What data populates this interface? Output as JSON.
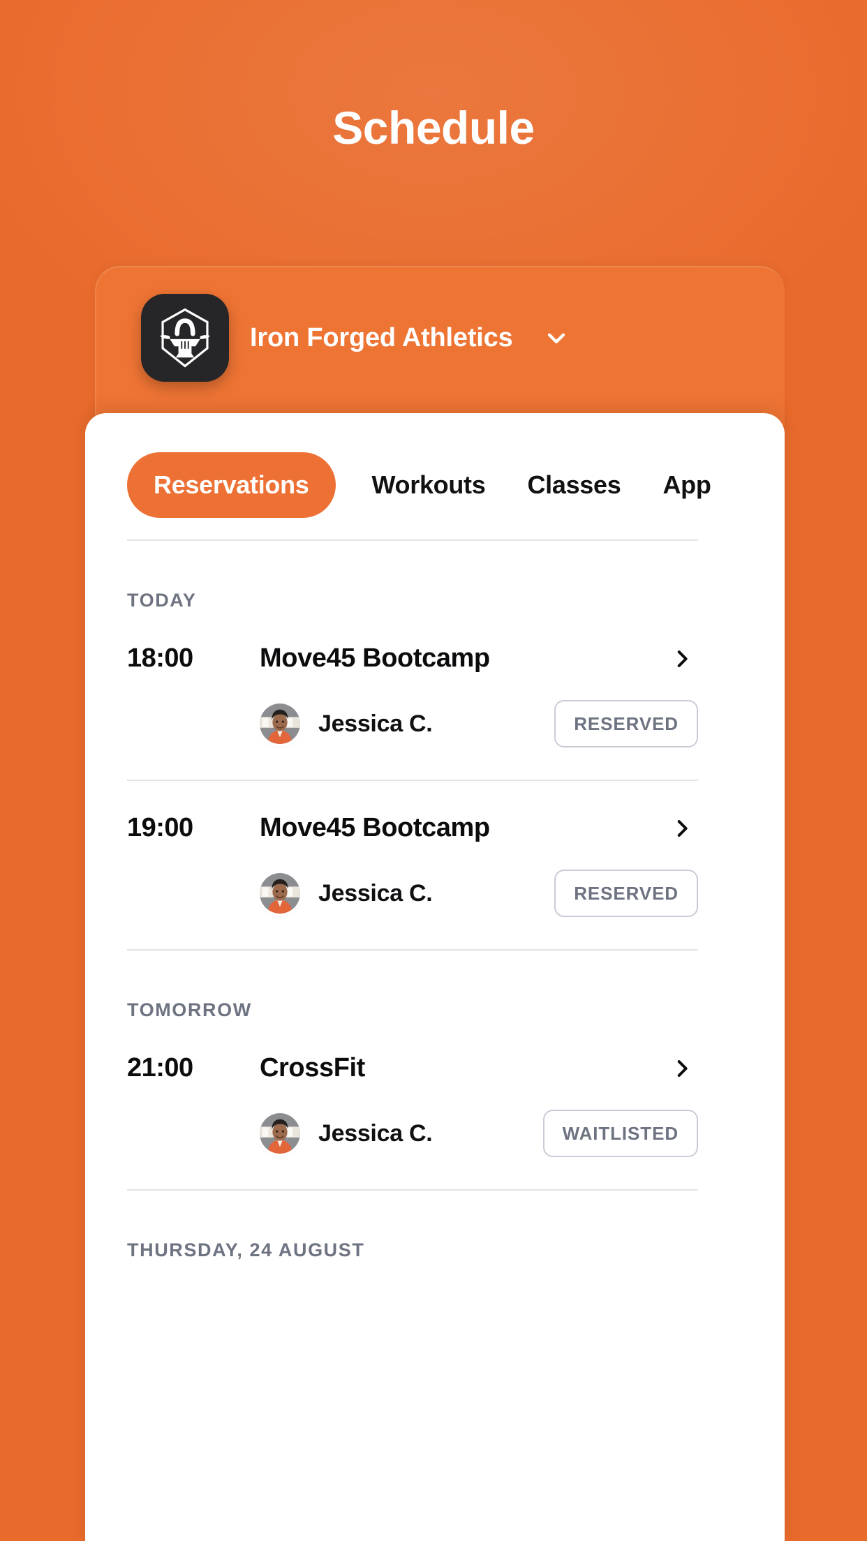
{
  "theme": {
    "brand_orange": "#E96B2C",
    "card_orange": "#EE7434",
    "accent_pill": "#ED7034",
    "text_dark": "#0C0C0E",
    "text_muted": "#6E7382",
    "divider": "#E2E4E8",
    "badge_border": "#C9CCD6",
    "logo_tile": "#262628"
  },
  "header": {
    "title": "Schedule"
  },
  "gym": {
    "name": "Iron Forged Athletics",
    "logo_icon": "anvil-shield-icon",
    "chevron_icon": "chevron-down-icon"
  },
  "tabs": [
    {
      "label": "Reservations",
      "active": true
    },
    {
      "label": "Workouts",
      "active": false
    },
    {
      "label": "Classes",
      "active": false
    },
    {
      "label": "App",
      "active": false
    }
  ],
  "groups": [
    {
      "day_label": "TODAY",
      "sessions": [
        {
          "time": "18:00",
          "name": "Move45 Bootcamp",
          "chevron_icon": "chevron-right-icon",
          "attendees": [
            {
              "name": "Jessica C.",
              "avatar_icon": "avatar-jessica",
              "status": "RESERVED"
            }
          ]
        },
        {
          "time": "19:00",
          "name": "Move45 Bootcamp",
          "chevron_icon": "chevron-right-icon",
          "attendees": [
            {
              "name": "Jessica C.",
              "avatar_icon": "avatar-jessica",
              "status": "RESERVED"
            }
          ]
        }
      ]
    },
    {
      "day_label": "TOMORROW",
      "sessions": [
        {
          "time": "21:00",
          "name": "CrossFit",
          "chevron_icon": "chevron-right-icon",
          "attendees": [
            {
              "name": "Jessica C.",
              "avatar_icon": "avatar-jessica",
              "status": "WAITLISTED"
            }
          ]
        }
      ]
    },
    {
      "day_label": "THURSDAY, 24 AUGUST",
      "sessions": []
    }
  ]
}
